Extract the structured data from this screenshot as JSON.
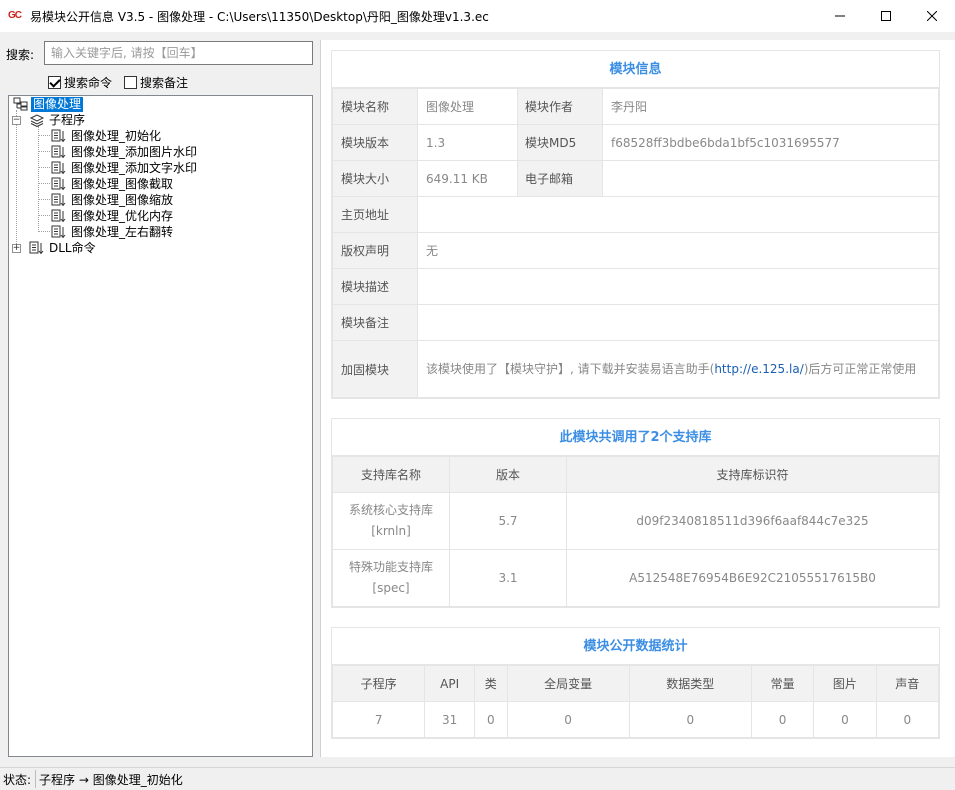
{
  "window": {
    "icon_text": "GC",
    "title": "易模块公开信息 V3.5 - 图像处理 - C:\\Users\\11350\\Desktop\\丹阳_图像处理v1.3.ec",
    "minimize_icon": "minimize-icon",
    "maximize_icon": "maximize-icon",
    "close_icon": "close-icon"
  },
  "search": {
    "label": "搜索:",
    "placeholder": "输入关键字后, 请按【回车】",
    "value": "",
    "options": [
      {
        "label": "搜索命令",
        "checked": true
      },
      {
        "label": "搜索备注",
        "checked": false
      }
    ]
  },
  "tree": {
    "root": "图像处理",
    "subprograms_label": "子程序",
    "subprograms": [
      "图像处理_初始化",
      "图像处理_添加图片水印",
      "图像处理_添加文字水印",
      "图像处理_图像截取",
      "图像处理_图像缩放",
      "图像处理_优化内存",
      "图像处理_左右翻转"
    ],
    "dll_label": "DLL命令"
  },
  "module_info": {
    "title": "模块信息",
    "name_label": "模块名称",
    "name": "图像处理",
    "author_label": "模块作者",
    "author": "李丹阳",
    "version_label": "模块版本",
    "version": "1.3",
    "md5_label": "模块MD5",
    "md5": "f68528ff3bdbe6bda1bf5c1031695577",
    "size_label": "模块大小",
    "size": "649.11 KB",
    "email_label": "电子邮箱",
    "email": "",
    "homepage_label": "主页地址",
    "homepage": "",
    "copyright_label": "版权声明",
    "copyright": "无",
    "desc_label": "模块描述",
    "desc": "",
    "note_label": "模块备注",
    "note": "",
    "protect_label": "加固模块",
    "protect_pre": "该模块使用了【模块守护】, 请下载并安装易语言助手(",
    "protect_link": "http://e.125.la/",
    "protect_post": ")后方可正常正常使用"
  },
  "libs": {
    "title": "此模块共调用了2个支持库",
    "headers": [
      "支持库名称",
      "版本",
      "支持库标识符"
    ],
    "rows": [
      {
        "name": "系统核心支持库",
        "code": "[krnln]",
        "version": "5.7",
        "id": "d09f2340818511d396f6aaf844c7e325"
      },
      {
        "name": "特殊功能支持库",
        "code": "[spec]",
        "version": "3.1",
        "id": "A512548E76954B6E92C21055517615B0"
      }
    ]
  },
  "stats": {
    "title": "模块公开数据统计",
    "headers": [
      "子程序",
      "API",
      "类",
      "全局变量",
      "数据类型",
      "常量",
      "图片",
      "声音"
    ],
    "values": [
      "7",
      "31",
      "0",
      "0",
      "0",
      "0",
      "0",
      "0"
    ]
  },
  "status": {
    "label": "状态:",
    "text": "子程序 → 图像处理_初始化"
  }
}
